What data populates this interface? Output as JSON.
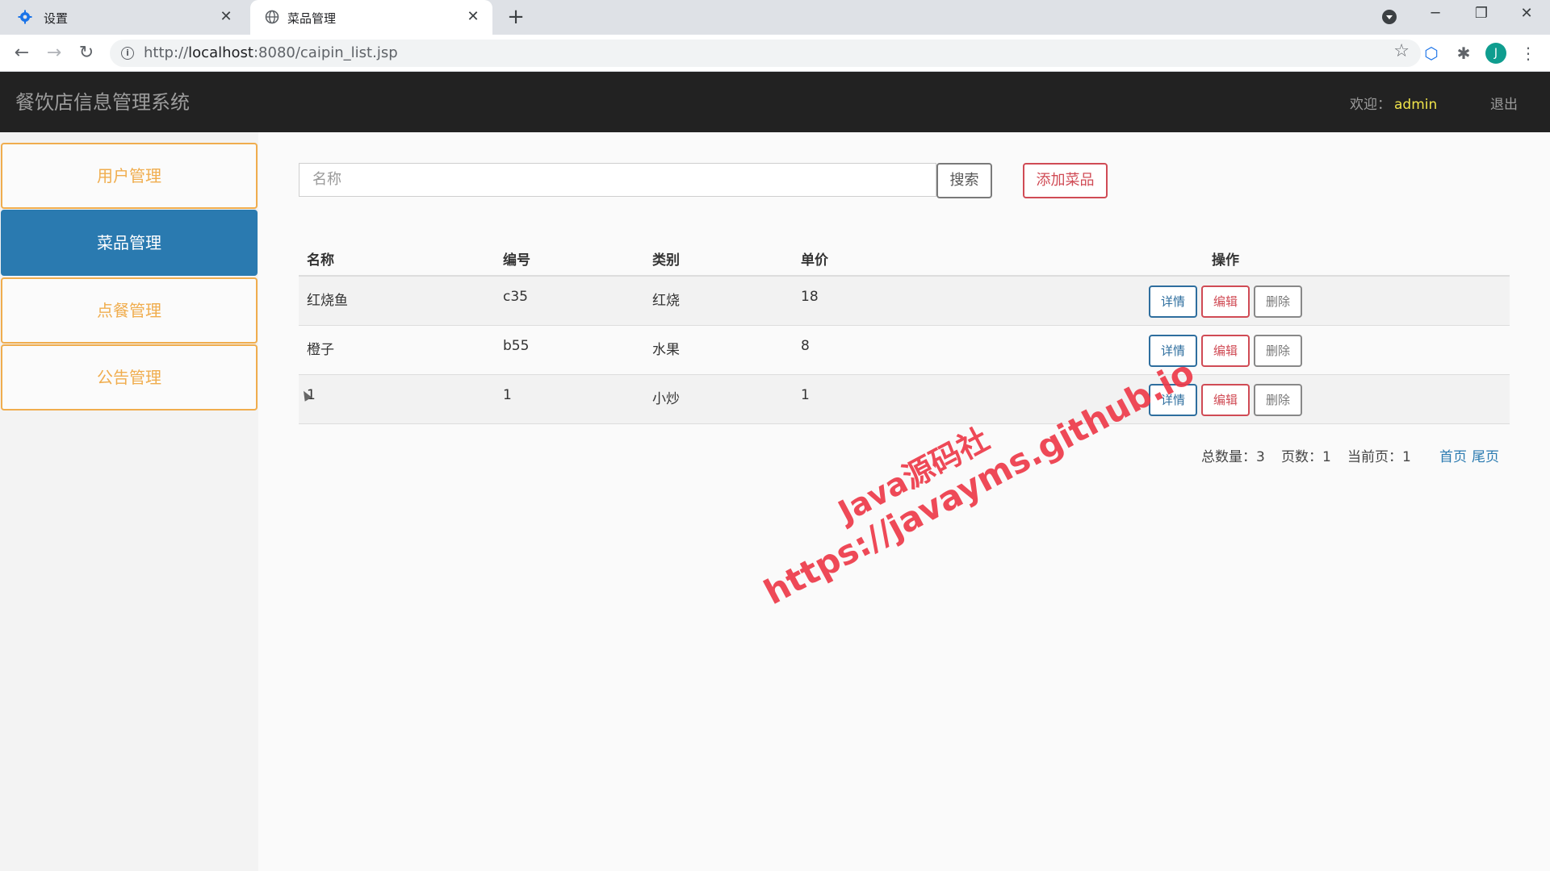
{
  "browser": {
    "tabs": [
      {
        "title": "设置",
        "icon": "gear-icon"
      },
      {
        "title": "菜品管理",
        "icon": "globe-icon"
      }
    ],
    "url_prefix": "http://",
    "url_host": "localhost",
    "url_rest": ":8080/caipin_list.jsp",
    "avatar_letter": "J"
  },
  "header": {
    "brand": "餐饮店信息管理系统",
    "welcome_label": "欢迎：",
    "username": "admin",
    "logout": "退出"
  },
  "sidebar": {
    "items": [
      {
        "label": "用户管理"
      },
      {
        "label": "菜品管理",
        "active": true
      },
      {
        "label": "点餐管理"
      },
      {
        "label": "公告管理"
      }
    ]
  },
  "search": {
    "placeholder": "名称",
    "button": "搜索",
    "add_button": "添加菜品"
  },
  "table": {
    "headers": [
      "名称",
      "编号",
      "类别",
      "单价",
      "操作"
    ],
    "rows": [
      {
        "name": "红烧鱼",
        "code": "c35",
        "category": "红烧",
        "price": "18"
      },
      {
        "name": "橙子",
        "code": "b55",
        "category": "水果",
        "price": "8"
      },
      {
        "name": "1",
        "code": "1",
        "category": "小炒",
        "price": "1"
      }
    ],
    "actions": {
      "detail": "详情",
      "edit": "编辑",
      "delete": "删除"
    }
  },
  "pager": {
    "total": "总数量：3",
    "pages": "页数：1",
    "current": "当前页：1",
    "first": "首页",
    "last": "尾页"
  },
  "watermark": {
    "line1": "Java源码社",
    "line2": "https://javayms.github.io"
  },
  "colors": {
    "accent": "#2a7ab0",
    "warning": "#f0ad4e",
    "danger": "#d04b55",
    "header_bg": "#222222"
  }
}
